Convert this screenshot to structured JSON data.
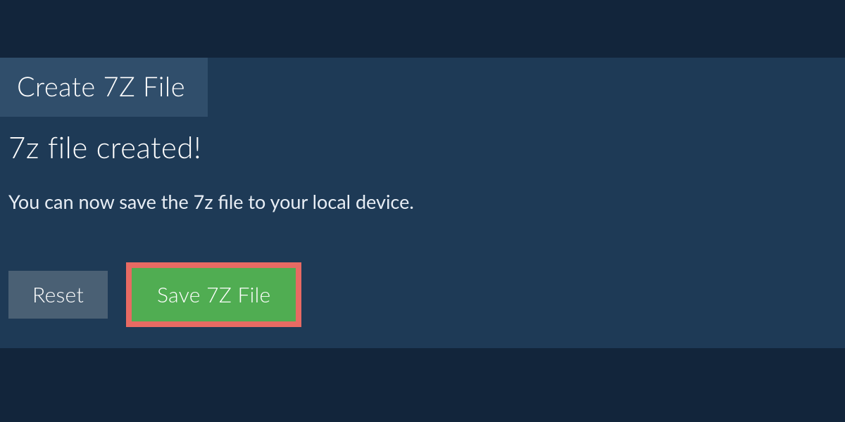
{
  "tab": {
    "label": "Create 7Z File"
  },
  "status": {
    "heading": "7z file created!",
    "description": "You can now save the 7z file to your local device."
  },
  "buttons": {
    "reset_label": "Reset",
    "save_label": "Save 7Z File"
  },
  "colors": {
    "background": "#12253b",
    "panel": "#1e3a56",
    "tab": "#304e6b",
    "reset_button": "#4a6074",
    "save_button": "#50ad52",
    "save_highlight": "#e86a63"
  }
}
